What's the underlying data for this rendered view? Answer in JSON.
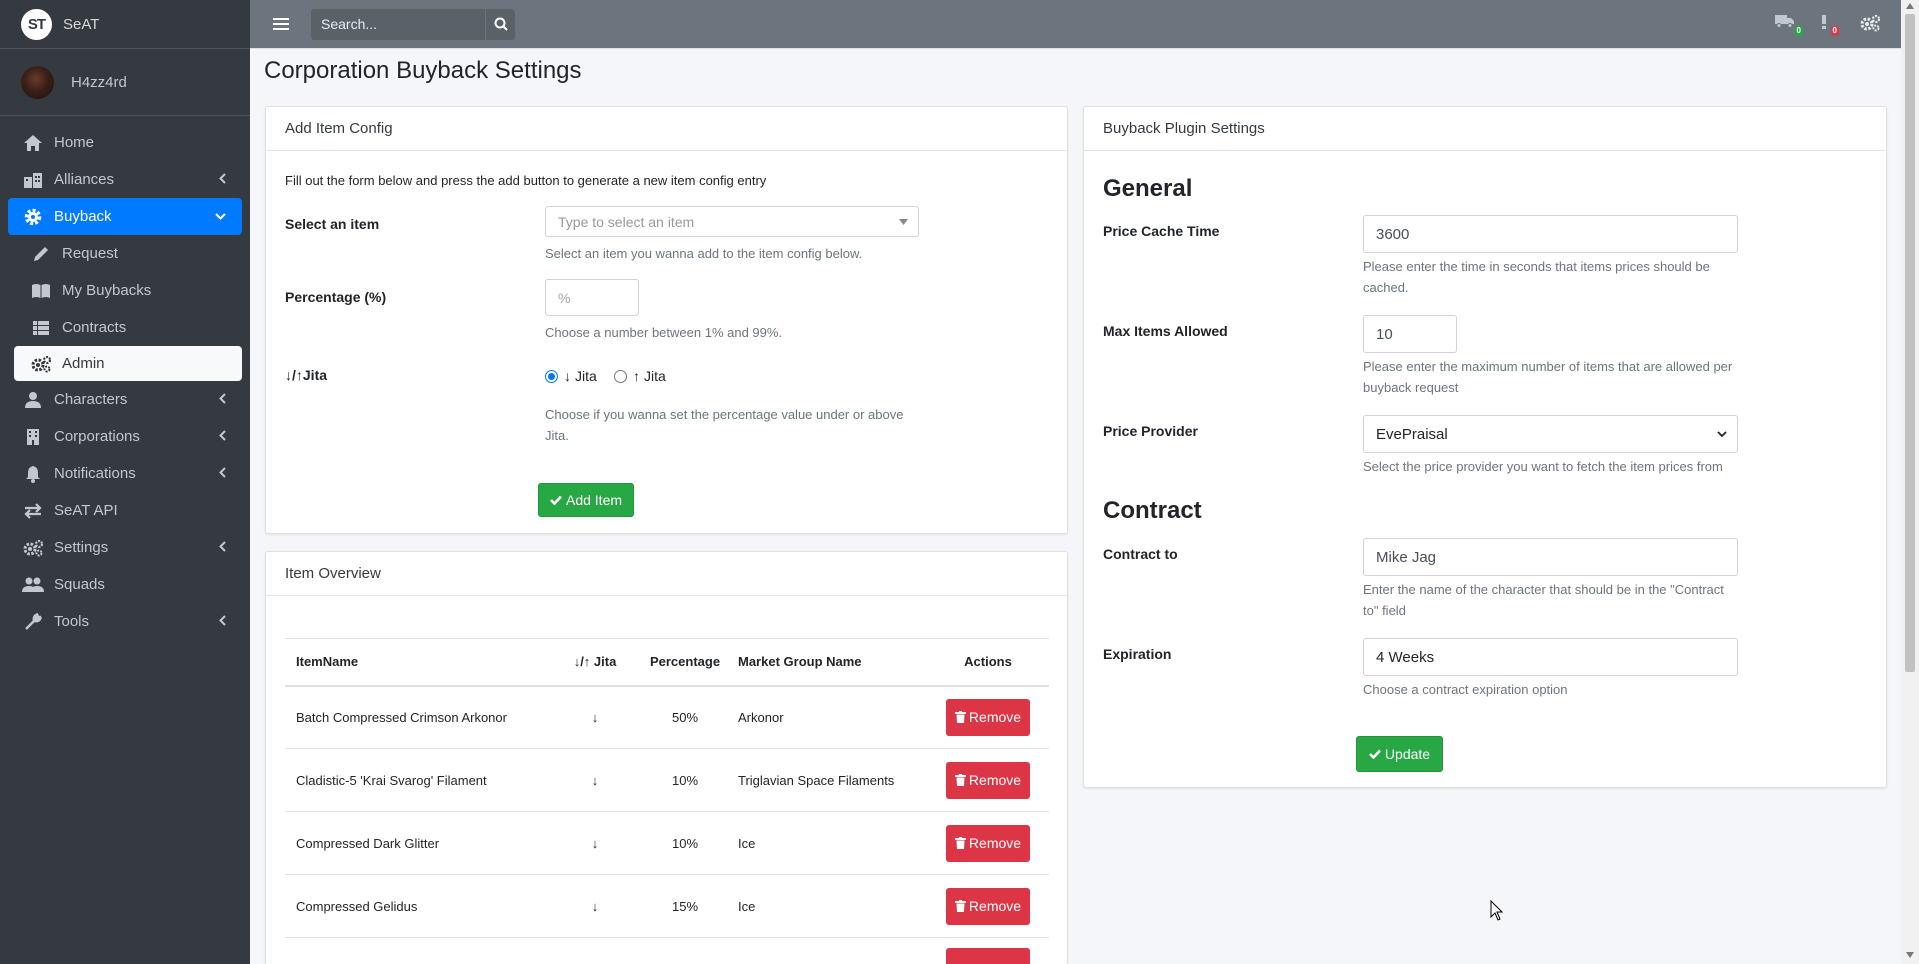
{
  "brand": {
    "logo": "ST",
    "name": "SeAT"
  },
  "user": {
    "name": "H4zz4rd"
  },
  "sidebar": {
    "items": [
      {
        "label": "Home",
        "icon": "home-icon"
      },
      {
        "label": "Alliances",
        "icon": "building-icon"
      },
      {
        "label": "Buyback",
        "icon": "gear-icon"
      },
      {
        "label": "Request",
        "icon": "pencil-icon"
      },
      {
        "label": "My Buybacks",
        "icon": "book-icon"
      },
      {
        "label": "Contracts",
        "icon": "table-icon"
      },
      {
        "label": "Admin",
        "icon": "cogs-icon"
      },
      {
        "label": "Characters",
        "icon": "user-icon"
      },
      {
        "label": "Corporations",
        "icon": "building-icon"
      },
      {
        "label": "Notifications",
        "icon": "bell-icon"
      },
      {
        "label": "SeAT API",
        "icon": "exchange-icon"
      },
      {
        "label": "Settings",
        "icon": "cogs-icon"
      },
      {
        "label": "Squads",
        "icon": "users-icon"
      },
      {
        "label": "Tools",
        "icon": "wrench-icon"
      }
    ]
  },
  "topbar": {
    "search_placeholder": "Search...",
    "queue_badge": "0",
    "error_badge": "0"
  },
  "page": {
    "title": "Corporation Buyback Settings"
  },
  "add_item": {
    "header": "Add Item Config",
    "intro": "Fill out the form below and press the add button to generate a new item config entry",
    "select_label": "Select an item",
    "select_placeholder": "Type to select an item",
    "select_help": "Select an item you wanna add to the item config below.",
    "percentage_label": "Percentage (%)",
    "percentage_placeholder": "%",
    "percentage_help": "Choose a number between 1% and 99%.",
    "jita_label": "↓/↑Jita",
    "radio_under": "Jita",
    "radio_above": "Jita",
    "jita_help": "Choose if you wanna set the percentage value under or above Jita.",
    "add_button": "Add Item"
  },
  "item_overview": {
    "header": "Item Overview",
    "columns": [
      "ItemName",
      "↓/↑ Jita",
      "Percentage",
      "Market Group Name",
      "Actions"
    ],
    "rows": [
      {
        "name": "Batch Compressed Crimson Arkonor",
        "dir": "↓",
        "pct": "50%",
        "group": "Arkonor",
        "action": "Remove"
      },
      {
        "name": "Cladistic-5 'Krai Svarog' Filament",
        "dir": "↓",
        "pct": "10%",
        "group": "Triglavian Space Filaments",
        "action": "Remove"
      },
      {
        "name": "Compressed Dark Glitter",
        "dir": "↓",
        "pct": "10%",
        "group": "Ice",
        "action": "Remove"
      },
      {
        "name": "Compressed Gelidus",
        "dir": "↓",
        "pct": "15%",
        "group": "Ice",
        "action": "Remove"
      }
    ]
  },
  "plugin": {
    "header": "Buyback Plugin Settings",
    "general_heading": "General",
    "cache_label": "Price Cache Time",
    "cache_value": "3600",
    "cache_help": "Please enter the time in seconds that items prices should be cached.",
    "max_label": "Max Items Allowed",
    "max_value": "10",
    "max_help": "Please enter the maximum number of items that are allowed per buyback request",
    "provider_label": "Price Provider",
    "provider_value": "EvePraisal",
    "provider_help": "Select the price provider you want to fetch the item prices from",
    "contract_heading": "Contract",
    "contract_to_label": "Contract to",
    "contract_to_value": "Mike Jag",
    "contract_to_help": "Enter the name of the character that should be in the \"Contract to\" field",
    "expiration_label": "Expiration",
    "expiration_value": "4 Weeks",
    "expiration_help": "Choose a contract expiration option",
    "update_button": "Update"
  },
  "colors": {
    "primary": "#007bff",
    "success": "#28a745",
    "danger": "#dc3545",
    "sidebar": "#343a40",
    "topbar": "#6c757d"
  }
}
